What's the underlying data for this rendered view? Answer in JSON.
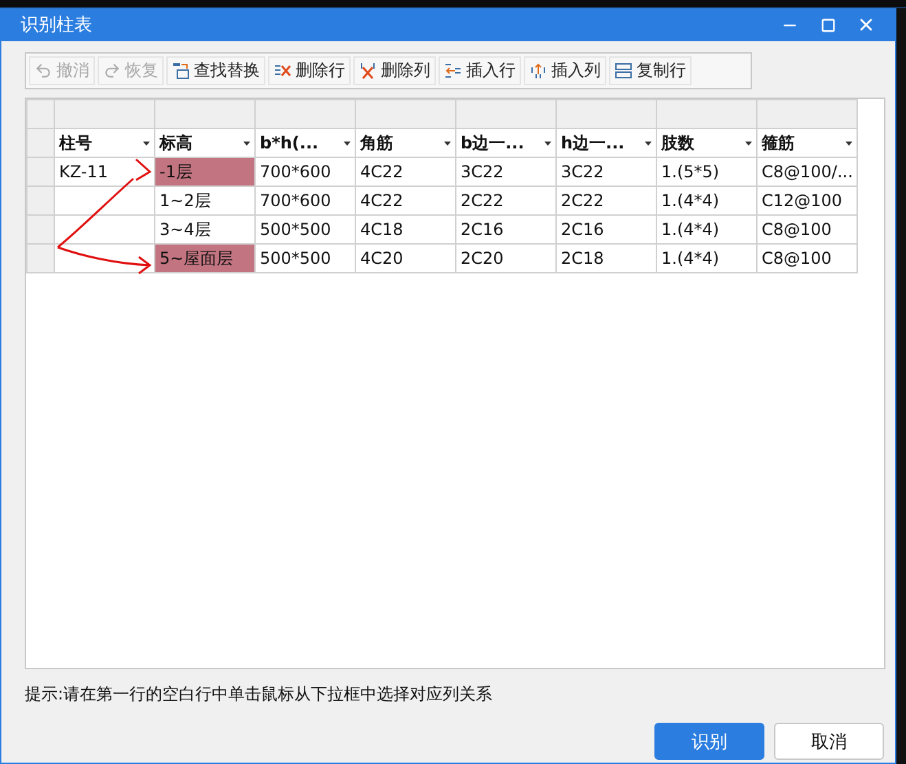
{
  "window": {
    "title": "识别柱表"
  },
  "toolbar": [
    {
      "kind": "undo",
      "label": "撤消",
      "disabled": true
    },
    {
      "kind": "redo",
      "label": "恢复",
      "disabled": true
    },
    {
      "kind": "find",
      "label": "查找替换",
      "disabled": false
    },
    {
      "kind": "delrow",
      "label": "删除行",
      "disabled": false
    },
    {
      "kind": "delcol",
      "label": "删除列",
      "disabled": false
    },
    {
      "kind": "insrow",
      "label": "插入行",
      "disabled": false
    },
    {
      "kind": "inscol",
      "label": "插入列",
      "disabled": false
    },
    {
      "kind": "copyrow",
      "label": "复制行",
      "disabled": false
    }
  ],
  "table": {
    "columns": [
      "柱号",
      "标高",
      "b*h(...",
      "角筋",
      "b边一...",
      "h边一...",
      "肢数",
      "箍筋"
    ],
    "rows": [
      {
        "cells": [
          {
            "text": "KZ-11",
            "highlighted": false
          },
          {
            "text": "-1层",
            "highlighted": true
          },
          {
            "text": "700*600",
            "highlighted": false
          },
          {
            "text": "4C22",
            "highlighted": false
          },
          {
            "text": "3C22",
            "highlighted": false
          },
          {
            "text": "3C22",
            "highlighted": false
          },
          {
            "text": "1.(5*5)",
            "highlighted": false
          },
          {
            "text": "C8@100/...",
            "highlighted": false
          }
        ]
      },
      {
        "cells": [
          {
            "text": "",
            "highlighted": false
          },
          {
            "text": "1~2层",
            "highlighted": false
          },
          {
            "text": "700*600",
            "highlighted": false
          },
          {
            "text": "4C22",
            "highlighted": false
          },
          {
            "text": "2C22",
            "highlighted": false
          },
          {
            "text": "2C22",
            "highlighted": false
          },
          {
            "text": "1.(4*4)",
            "highlighted": false
          },
          {
            "text": "C12@100",
            "highlighted": false
          }
        ]
      },
      {
        "cells": [
          {
            "text": "",
            "highlighted": false
          },
          {
            "text": "3~4层",
            "highlighted": false
          },
          {
            "text": "500*500",
            "highlighted": false
          },
          {
            "text": "4C18",
            "highlighted": false
          },
          {
            "text": "2C16",
            "highlighted": false
          },
          {
            "text": "2C16",
            "highlighted": false
          },
          {
            "text": "1.(4*4)",
            "highlighted": false
          },
          {
            "text": "C8@100",
            "highlighted": false
          }
        ]
      },
      {
        "cells": [
          {
            "text": "",
            "highlighted": false
          },
          {
            "text": "5~屋面层",
            "highlighted": true
          },
          {
            "text": "500*500",
            "highlighted": false
          },
          {
            "text": "4C20",
            "highlighted": false
          },
          {
            "text": "2C20",
            "highlighted": false
          },
          {
            "text": "2C18",
            "highlighted": false
          },
          {
            "text": "1.(4*4)",
            "highlighted": false
          },
          {
            "text": "C8@100",
            "highlighted": false
          }
        ]
      }
    ]
  },
  "hint": "提示:请在第一行的空白行中单击鼠标从下拉框中选择对应列关系",
  "buttons": [
    {
      "label": "识别",
      "primary": true
    },
    {
      "label": "取消",
      "primary": false
    }
  ]
}
